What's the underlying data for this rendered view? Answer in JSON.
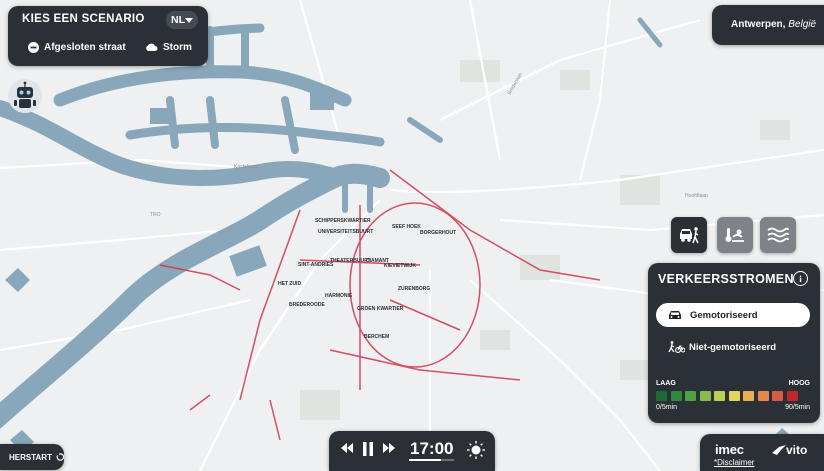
{
  "scenario": {
    "title": "KIES EEN SCENARIO",
    "language": "NL",
    "options": [
      {
        "label": "Afgesloten straat",
        "icon": "minus-circle-icon"
      },
      {
        "label": "Storm",
        "icon": "cloud-icon"
      }
    ]
  },
  "location": {
    "city": "Antwerpen,",
    "country": "België"
  },
  "modes": [
    "traffic-icon",
    "heat-icon",
    "water-icon"
  ],
  "traffic": {
    "title": "VERKEERSSTROMEN",
    "info": "i",
    "motorized": "Gemotoriseerd",
    "non_motorized": "Niet-gemotoriseerd",
    "legend": {
      "low": "LAAG",
      "high": "HOOG",
      "min_value": "0/5min",
      "max_value": "90/5min",
      "colors": [
        "#1e6b35",
        "#2e8a3d",
        "#4ea243",
        "#86bb4e",
        "#b9cf57",
        "#e3d55a",
        "#e9ad53",
        "#e5864a",
        "#d85b45",
        "#c1272d"
      ]
    }
  },
  "restart": {
    "label": "HERSTART"
  },
  "player": {
    "time": "17:00",
    "progress": 0.72
  },
  "logos": {
    "imec": "imec",
    "vito": "vito",
    "disclaimer": "*Disclaimer"
  },
  "map_labels": {
    "districts": [
      "SCHIPPERSKWARTIER",
      "UNIVERSITEITSBUURT",
      "SEEF HOEK",
      "BORGERHOUT",
      "THEATERBUURT",
      "DIAMANT",
      "SINT-ANDRIES",
      "KIEVIETWIJK",
      "HET ZUID",
      "ZURENBORG",
      "HARMONIE",
      "BREDEROODE",
      "GROEN KWARTIER",
      "BERCHEM"
    ],
    "streets": [
      "Kastelweg",
      "TRO",
      "Bredabaan",
      "Hoofdlaan"
    ]
  },
  "colors": {
    "water": "#89a7ba",
    "panel": "#2b3036",
    "traffic_line": "#d2324a"
  }
}
